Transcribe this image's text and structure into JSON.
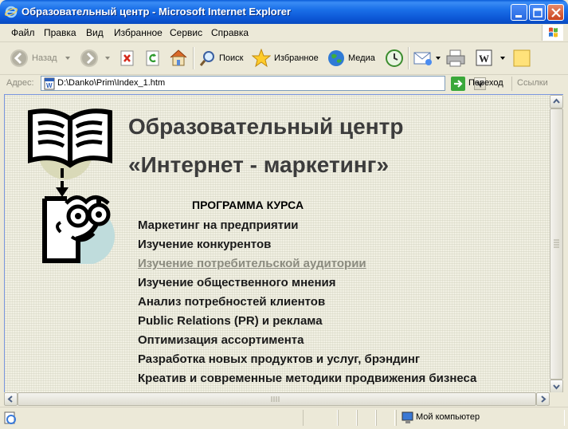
{
  "window": {
    "title": "Образовательный центр - Microsoft Internet Explorer"
  },
  "menu": [
    "Файл",
    "Правка",
    "Вид",
    "Избранное",
    "Сервис",
    "Справка"
  ],
  "toolbar": {
    "back_label": "Назад",
    "search_label": "Поиск",
    "favorites_label": "Избранное",
    "media_label": "Медиа"
  },
  "address": {
    "label": "Адрес:",
    "value": "D:\\Danko\\Prim\\Index_1.htm",
    "go_label": "Переход",
    "links_label": "Ссылки"
  },
  "page": {
    "title_line1": "Образовательный центр",
    "title_line2": "«Интернет - маркетинг»",
    "program_heading": "ПРОГРАММА КУРСА",
    "courses": [
      "Маркетинг на предприятии",
      "Изучение конкурентов",
      "Изучение потребительской аудитории",
      "Изучение общественного мнения",
      "Анализ потребностей клиентов",
      "Public Relations (PR) и реклама",
      "Оптимизация ассортимента",
      "Разработка новых продуктов и услуг, брэндинг",
      "Креатив и современные методики продвижения бизнеса"
    ]
  },
  "status": {
    "zone": "Мой компьютер"
  },
  "colors": {
    "titlebar": "#0a5cd8",
    "visited_link": "#8c8c80",
    "heading": "#3c3c3c"
  }
}
